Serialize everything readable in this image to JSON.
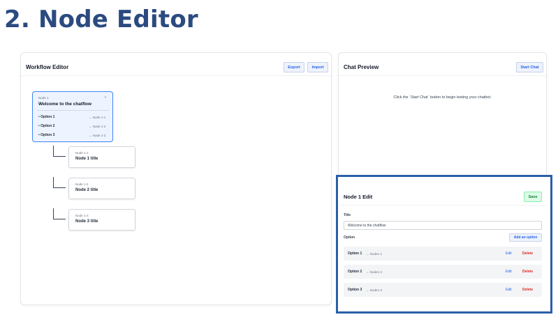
{
  "page": {
    "heading": "2. Node Editor"
  },
  "workflow": {
    "title": "Workflow Editor",
    "export_label": "Export",
    "import_label": "Import",
    "root": {
      "id": "Node 1",
      "title": "Welcome to the chatflow",
      "add_icon": "plus-icon",
      "options": [
        {
          "label": "• Option 1",
          "target": "→ Node 1-1"
        },
        {
          "label": "• Option 2",
          "target": "→ Node 1-2"
        },
        {
          "label": "• Option 3",
          "target": "→ Node 1-3"
        }
      ]
    },
    "children": [
      {
        "id": "Node 1-1",
        "title": "Node 1 title"
      },
      {
        "id": "Node 1-2",
        "title": "Node 2 title"
      },
      {
        "id": "Node 1-3",
        "title": "Node 3 title"
      }
    ]
  },
  "chat": {
    "title": "Chat Preview",
    "start_label": "Start Chat",
    "hint": "Click the `Start Chat` button to begin testing your chatbot."
  },
  "editor": {
    "title": "Node 1 Edit",
    "save_label": "Save",
    "title_field_label": "Title",
    "title_value": "Welcome to the chatflow",
    "option_label": "Option",
    "add_option_label": "Add an option",
    "options": [
      {
        "label": "Option 1",
        "target": "→ Node1-1",
        "edit": "Edit",
        "delete": "Delete"
      },
      {
        "label": "Option 2",
        "target": "→ Node1-2",
        "edit": "Edit",
        "delete": "Delete"
      },
      {
        "label": "Option 3",
        "target": "→ Node1-3",
        "edit": "Edit",
        "delete": "Delete"
      }
    ]
  },
  "colors": {
    "heading": "#2b4a80",
    "accent": "#2563eb",
    "highlight_border": "#2b5fa8",
    "save_green": "#15803d",
    "delete_red": "#dc2626"
  }
}
